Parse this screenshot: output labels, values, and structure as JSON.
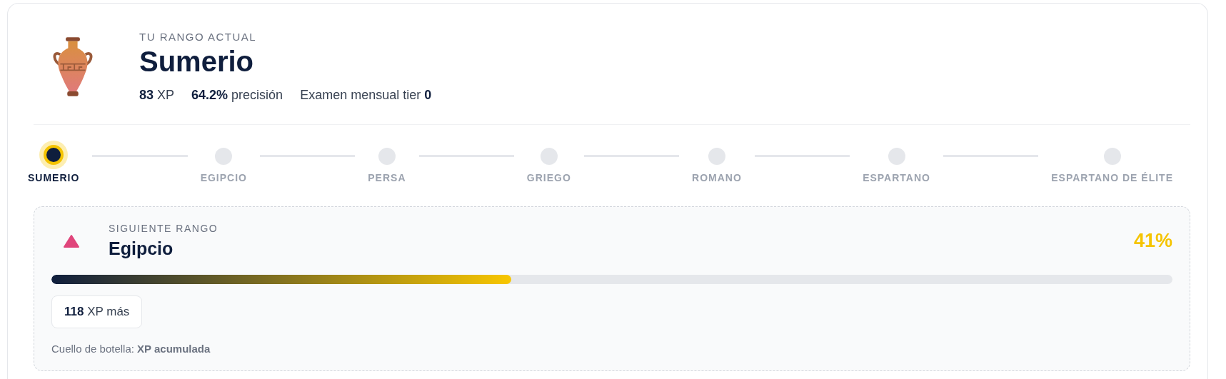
{
  "current_rank": {
    "eyebrow": "TU RANGO ACTUAL",
    "name": "Sumerio",
    "stats": [
      "**83** XP",
      "**64.2%** precisión",
      "Examen mensual tier **0**"
    ]
  },
  "ranks": [
    {
      "label": "SUMERIO",
      "selected": true
    },
    {
      "label": "EGIPCIO",
      "selected": false
    },
    {
      "label": "PERSA",
      "selected": false
    },
    {
      "label": "GRIEGO",
      "selected": false
    },
    {
      "label": "ROMANO",
      "selected": false
    },
    {
      "label": "ESPARTANO",
      "selected": false
    },
    {
      "label": "ESPARTANO DE ÉLITE",
      "selected": false
    }
  ],
  "next_rank": {
    "eyebrow": "SIGUIENTE RANGO",
    "name": "Egipcio",
    "percent": "41%",
    "level": 0.41,
    "remaining": {
      "value": "118",
      "label": "XP más"
    },
    "bottleneck": "Cuello de botella: **XP acumulada**"
  }
}
